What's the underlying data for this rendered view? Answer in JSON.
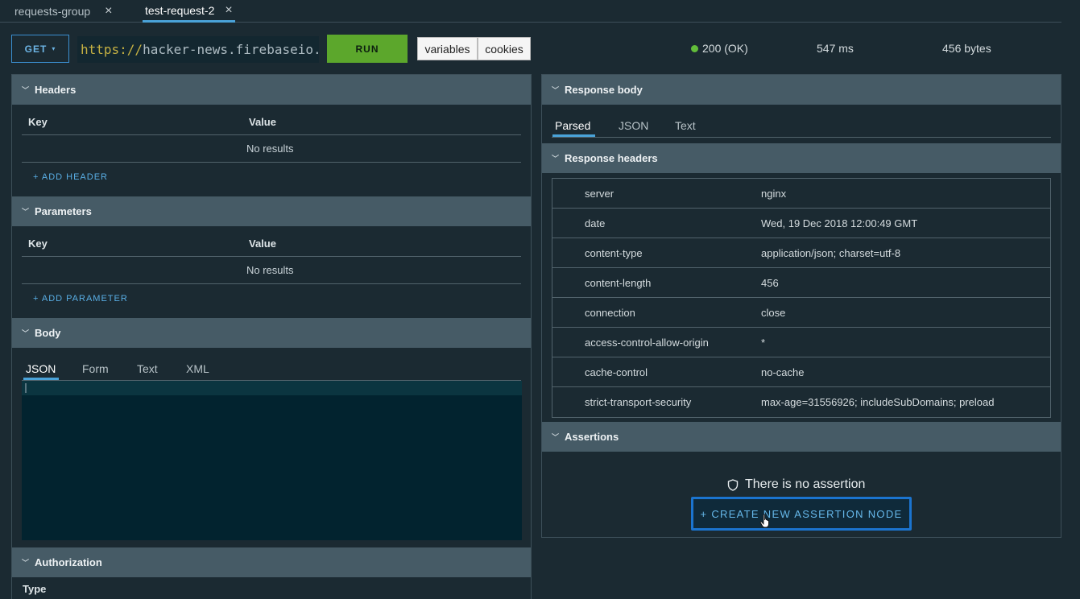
{
  "tabs": [
    {
      "label": "requests-group",
      "close": "×"
    },
    {
      "label": "test-request-2",
      "close": "×"
    }
  ],
  "toolbar": {
    "method": "GET",
    "method_chevron": "⌄",
    "url_protocol": "https://",
    "url_host": "hacker-news.firebaseio.",
    "run_label": "RUN",
    "variables_label": "variables",
    "cookies_label": "cookies"
  },
  "status": {
    "code": "200 (OK)",
    "time": "547 ms",
    "size": "456 bytes",
    "status_color": "#62bd3a"
  },
  "request": {
    "headers": {
      "title": "Headers",
      "key_col": "Key",
      "value_col": "Value",
      "empty": "No results",
      "add": "+ ADD HEADER"
    },
    "parameters": {
      "title": "Parameters",
      "key_col": "Key",
      "value_col": "Value",
      "empty": "No results",
      "add": "+ ADD PARAMETER"
    },
    "body": {
      "title": "Body",
      "tabs": [
        "JSON",
        "Form",
        "Text",
        "XML"
      ],
      "active_tab": "JSON"
    },
    "authorization": {
      "title": "Authorization",
      "type_label": "Type"
    }
  },
  "response": {
    "body": {
      "title": "Response body",
      "tabs": [
        "Parsed",
        "JSON",
        "Text"
      ],
      "active_tab": "Parsed"
    },
    "headers": {
      "title": "Response headers",
      "rows": [
        {
          "key": "server",
          "value": "nginx"
        },
        {
          "key": "date",
          "value": "Wed, 19 Dec 2018 12:00:49 GMT"
        },
        {
          "key": "content-type",
          "value": "application/json; charset=utf-8"
        },
        {
          "key": "content-length",
          "value": "456"
        },
        {
          "key": "connection",
          "value": "close"
        },
        {
          "key": "access-control-allow-origin",
          "value": "*"
        },
        {
          "key": "cache-control",
          "value": "no-cache"
        },
        {
          "key": "strict-transport-security",
          "value": "max-age=31556926; includeSubDomains; preload"
        }
      ]
    },
    "assertions": {
      "title": "Assertions",
      "empty": "There is no assertion",
      "create": "+ CREATE NEW ASSERTION NODE"
    }
  },
  "icons": {
    "chevron": "⌄",
    "shield": "shield-icon",
    "pointer": "hand-cursor-icon"
  },
  "colors": {
    "accent": "#4aa3d9",
    "run": "#5ca72c",
    "section_header": "#465b66",
    "background": "#1b2a32"
  }
}
